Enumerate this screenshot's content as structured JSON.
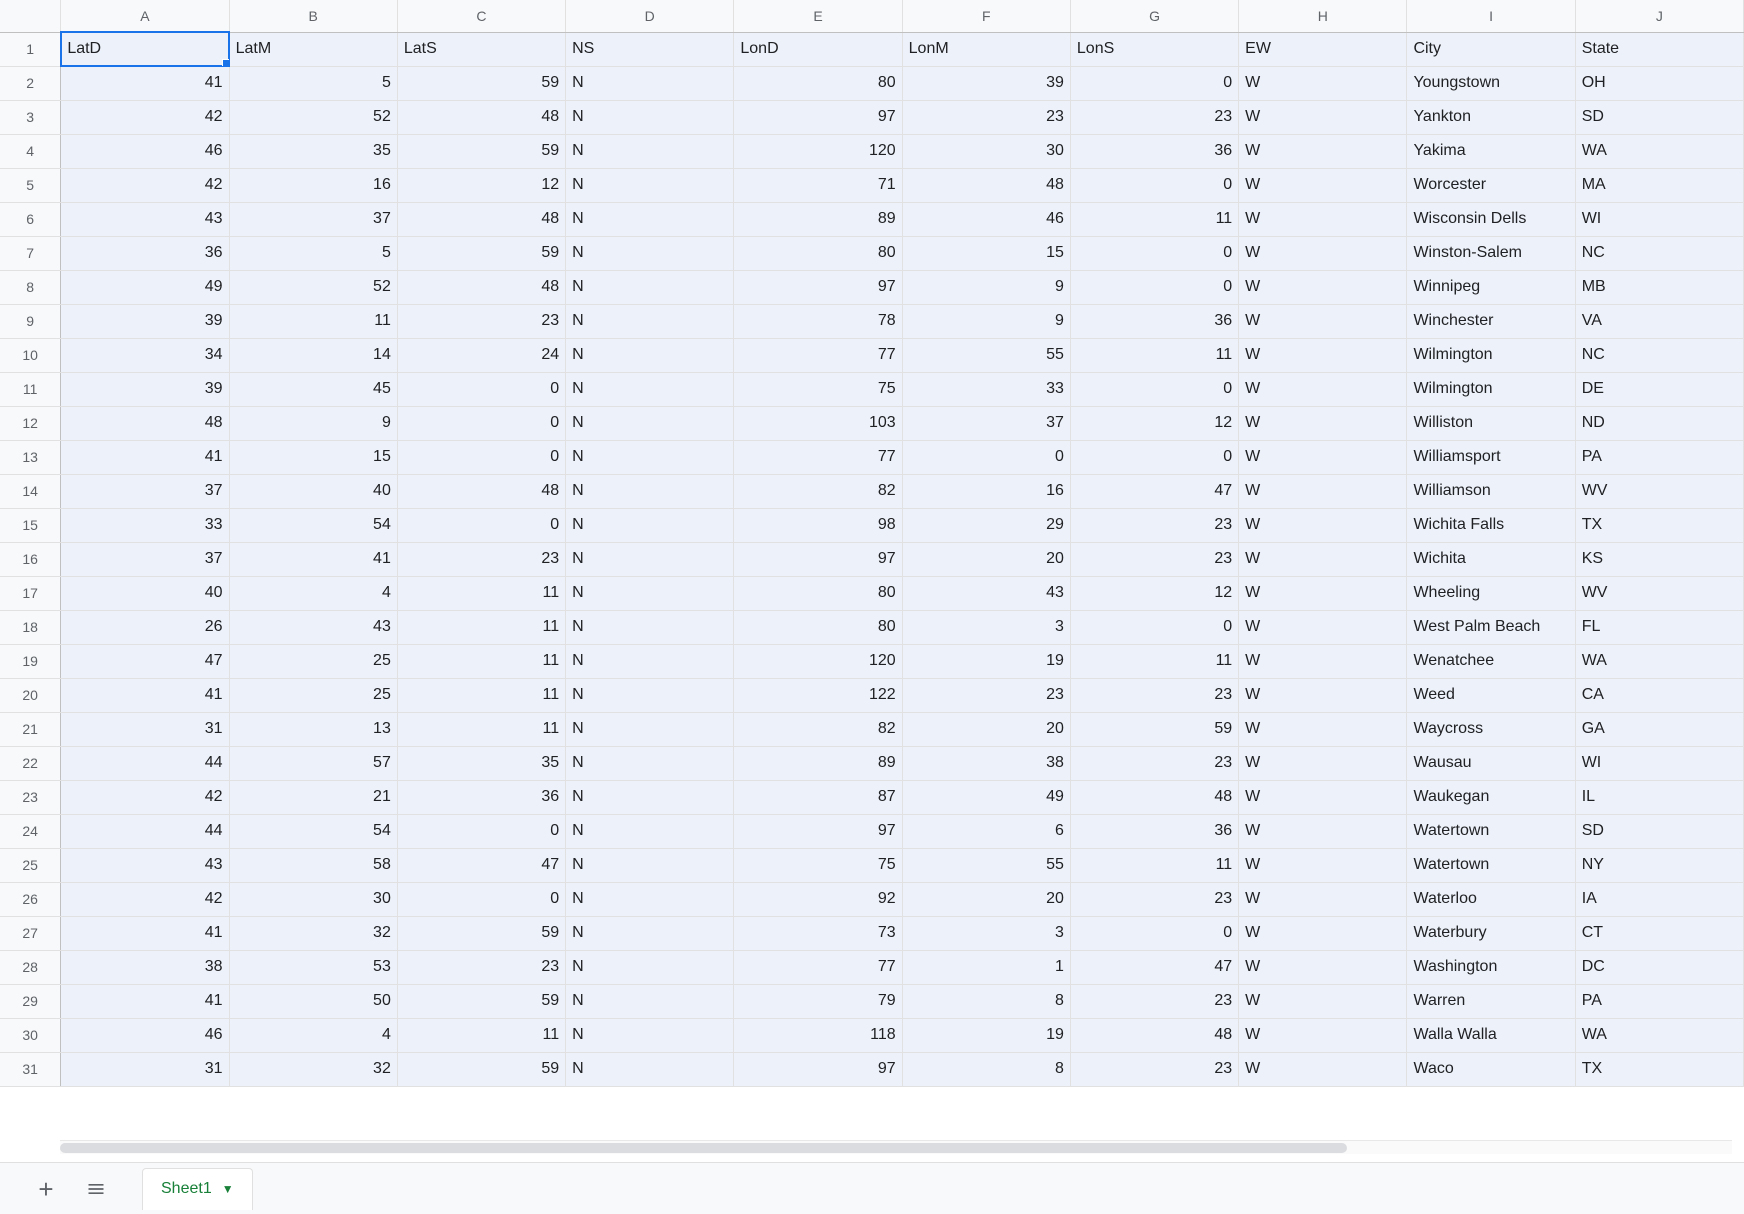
{
  "columns": [
    "A",
    "B",
    "C",
    "D",
    "E",
    "F",
    "G",
    "H",
    "I",
    "J"
  ],
  "row_numbers": [
    "1",
    "2",
    "3",
    "4",
    "5",
    "6",
    "7",
    "8",
    "9",
    "10",
    "11",
    "12",
    "13",
    "14",
    "15",
    "16",
    "17",
    "18",
    "19",
    "20",
    "21",
    "22",
    "23",
    "24",
    "25",
    "26",
    "27",
    "28",
    "29",
    "30",
    "31"
  ],
  "headers": [
    "LatD",
    "LatM",
    "LatS",
    "NS",
    "LonD",
    "LonM",
    "LonS",
    "EW",
    "City",
    "State"
  ],
  "rows": [
    [
      "41",
      "5",
      "59",
      "N",
      "80",
      "39",
      "0",
      "W",
      "Youngstown",
      "OH"
    ],
    [
      "42",
      "52",
      "48",
      "N",
      "97",
      "23",
      "23",
      "W",
      "Yankton",
      "SD"
    ],
    [
      "46",
      "35",
      "59",
      "N",
      "120",
      "30",
      "36",
      "W",
      "Yakima",
      "WA"
    ],
    [
      "42",
      "16",
      "12",
      "N",
      "71",
      "48",
      "0",
      "W",
      "Worcester",
      "MA"
    ],
    [
      "43",
      "37",
      "48",
      "N",
      "89",
      "46",
      "11",
      "W",
      "Wisconsin Dells",
      "WI"
    ],
    [
      "36",
      "5",
      "59",
      "N",
      "80",
      "15",
      "0",
      "W",
      "Winston-Salem",
      "NC"
    ],
    [
      "49",
      "52",
      "48",
      "N",
      "97",
      "9",
      "0",
      "W",
      "Winnipeg",
      "MB"
    ],
    [
      "39",
      "11",
      "23",
      "N",
      "78",
      "9",
      "36",
      "W",
      "Winchester",
      "VA"
    ],
    [
      "34",
      "14",
      "24",
      "N",
      "77",
      "55",
      "11",
      "W",
      "Wilmington",
      "NC"
    ],
    [
      "39",
      "45",
      "0",
      "N",
      "75",
      "33",
      "0",
      "W",
      "Wilmington",
      "DE"
    ],
    [
      "48",
      "9",
      "0",
      "N",
      "103",
      "37",
      "12",
      "W",
      "Williston",
      "ND"
    ],
    [
      "41",
      "15",
      "0",
      "N",
      "77",
      "0",
      "0",
      "W",
      "Williamsport",
      "PA"
    ],
    [
      "37",
      "40",
      "48",
      "N",
      "82",
      "16",
      "47",
      "W",
      "Williamson",
      "WV"
    ],
    [
      "33",
      "54",
      "0",
      "N",
      "98",
      "29",
      "23",
      "W",
      "Wichita Falls",
      "TX"
    ],
    [
      "37",
      "41",
      "23",
      "N",
      "97",
      "20",
      "23",
      "W",
      "Wichita",
      "KS"
    ],
    [
      "40",
      "4",
      "11",
      "N",
      "80",
      "43",
      "12",
      "W",
      "Wheeling",
      "WV"
    ],
    [
      "26",
      "43",
      "11",
      "N",
      "80",
      "3",
      "0",
      "W",
      "West Palm Beach",
      "FL"
    ],
    [
      "47",
      "25",
      "11",
      "N",
      "120",
      "19",
      "11",
      "W",
      "Wenatchee",
      "WA"
    ],
    [
      "41",
      "25",
      "11",
      "N",
      "122",
      "23",
      "23",
      "W",
      "Weed",
      "CA"
    ],
    [
      "31",
      "13",
      "11",
      "N",
      "82",
      "20",
      "59",
      "W",
      "Waycross",
      "GA"
    ],
    [
      "44",
      "57",
      "35",
      "N",
      "89",
      "38",
      "23",
      "W",
      "Wausau",
      "WI"
    ],
    [
      "42",
      "21",
      "36",
      "N",
      "87",
      "49",
      "48",
      "W",
      "Waukegan",
      "IL"
    ],
    [
      "44",
      "54",
      "0",
      "N",
      "97",
      "6",
      "36",
      "W",
      "Watertown",
      "SD"
    ],
    [
      "43",
      "58",
      "47",
      "N",
      "75",
      "55",
      "11",
      "W",
      "Watertown",
      "NY"
    ],
    [
      "42",
      "30",
      "0",
      "N",
      "92",
      "20",
      "23",
      "W",
      "Waterloo",
      "IA"
    ],
    [
      "41",
      "32",
      "59",
      "N",
      "73",
      "3",
      "0",
      "W",
      "Waterbury",
      "CT"
    ],
    [
      "38",
      "53",
      "23",
      "N",
      "77",
      "1",
      "47",
      "W",
      "Washington",
      "DC"
    ],
    [
      "41",
      "50",
      "59",
      "N",
      "79",
      "8",
      "23",
      "W",
      "Warren",
      "PA"
    ],
    [
      "46",
      "4",
      "11",
      "N",
      "118",
      "19",
      "48",
      "W",
      "Walla Walla",
      "WA"
    ],
    [
      "31",
      "32",
      "59",
      "N",
      "97",
      "8",
      "23",
      "W",
      "Waco",
      "TX"
    ]
  ],
  "numeric_cols": [
    0,
    1,
    2,
    4,
    5,
    6
  ],
  "active_cell": {
    "row": 0,
    "col": 0
  },
  "sheet_tab": {
    "name": "Sheet1"
  }
}
